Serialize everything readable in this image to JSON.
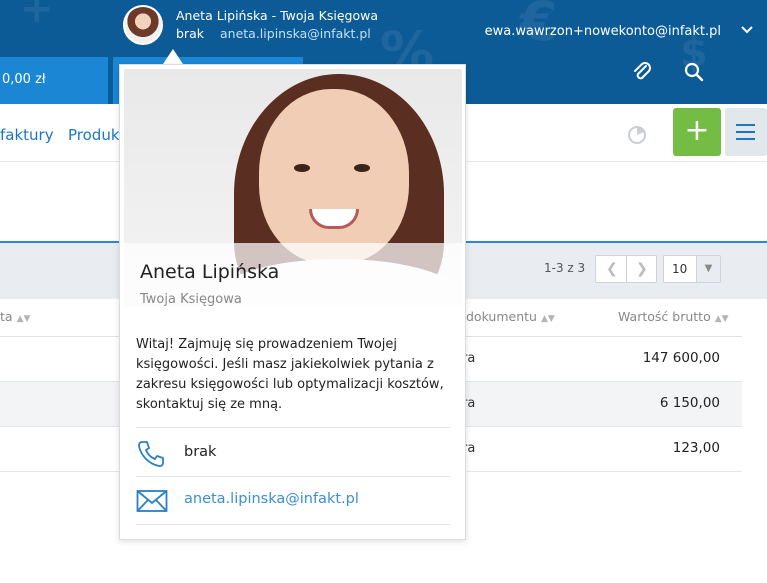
{
  "header": {
    "accountant_name": "Aneta Lipińska - Twoja Księgowa",
    "accountant_phone": "brak",
    "accountant_email": "aneta.lipinska@infakt.pl",
    "user_email": "ewa.wawrzon+nowekonto@infakt.pl",
    "user_menu_icon": "chevron-down-icon",
    "balance": "0,00 zł",
    "attachment_icon": "paperclip-icon",
    "search_icon": "search-icon",
    "brand_color": "#0d5b96"
  },
  "nav": {
    "items": [
      {
        "label": "faktury"
      },
      {
        "label": "Produkt"
      }
    ],
    "chart_icon": "pie-chart-icon",
    "add_label": "+",
    "add_color": "#74bd45",
    "menu_icon": "hamburger-icon"
  },
  "table": {
    "pagination_text": "1-3 z 3",
    "per_page": "10",
    "columns": [
      {
        "label": "ta"
      },
      {
        "label": "dokumentu"
      },
      {
        "label": "Wartość brutto"
      }
    ],
    "rows": [
      {
        "type_fragment": "ra",
        "gross": "147 600,00"
      },
      {
        "type_fragment": "ra",
        "gross": "6 150,00"
      },
      {
        "type_fragment": "ra",
        "gross": "123,00"
      }
    ]
  },
  "popover": {
    "name": "Aneta Lipińska",
    "role": "Twoja Księgowa",
    "description": "Witaj! Zajmuję się prowadzeniem Twojej księgowości. Jeśli masz jakiekolwiek pytania z zakresu księgowości lub optymalizacji kosztów, skontaktuj się ze mną.",
    "phone_icon": "phone-icon",
    "phone": "brak",
    "mail_icon": "envelope-icon",
    "email": "aneta.lipinska@infakt.pl",
    "link_color": "#3b8fd3"
  }
}
